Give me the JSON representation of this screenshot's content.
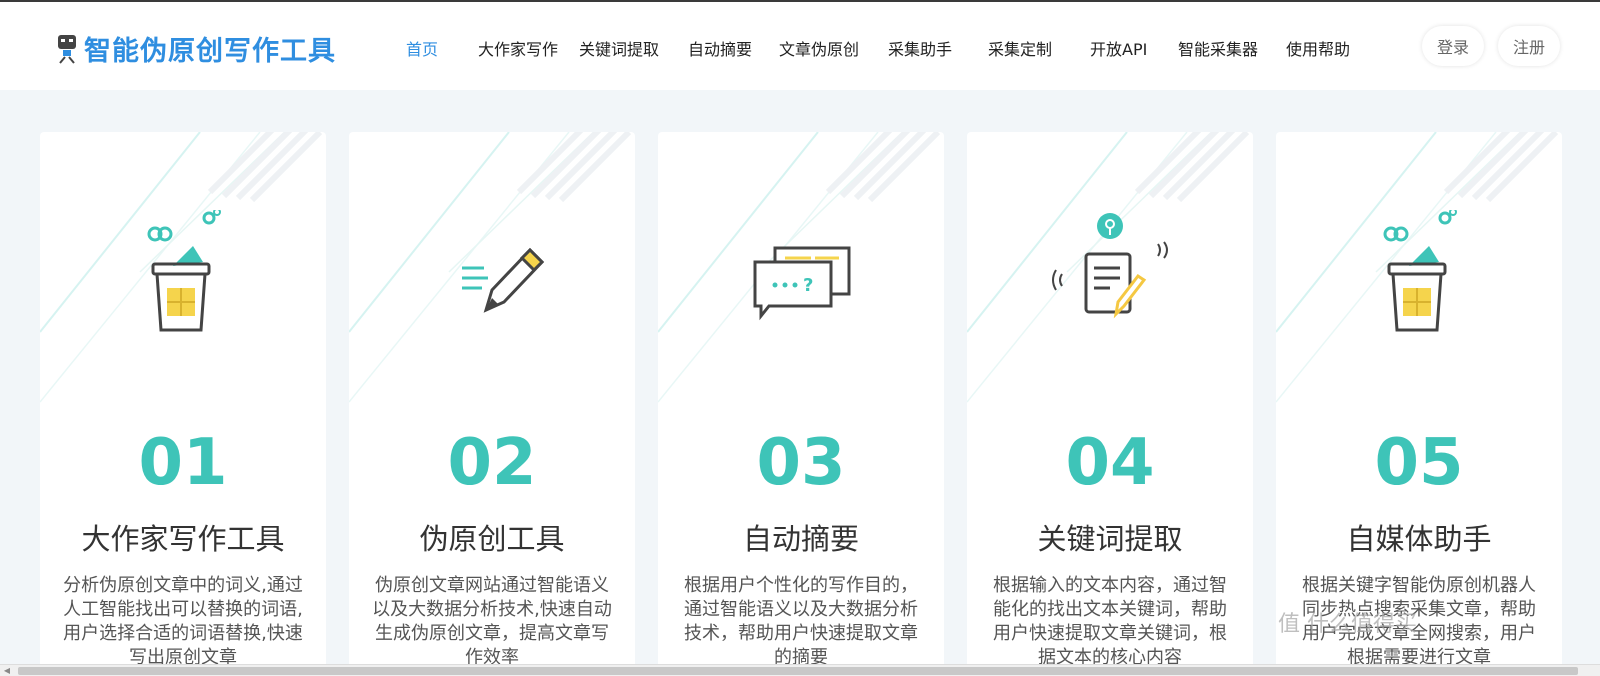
{
  "header": {
    "logo_text": "智能伪原创写作工具",
    "nav": [
      {
        "label": "首页",
        "active": true
      },
      {
        "label": "大作家写作"
      },
      {
        "label": "关键词提取"
      },
      {
        "label": "自动摘要"
      },
      {
        "label": "文章伪原创"
      },
      {
        "label": "采集助手"
      },
      {
        "label": "采集定制"
      },
      {
        "label": "开放API"
      },
      {
        "label": "智能采集器"
      },
      {
        "label": "使用帮助"
      }
    ],
    "login_label": "登录",
    "register_label": "注册"
  },
  "cards": [
    {
      "number": "01",
      "title": "大作家写作工具",
      "icon": "cup-social-icon",
      "desc": "分析伪原创文章中的词义,通过人工智能找出可以替换的词语,用户选择合适的词语替换,快速写出原创文章"
    },
    {
      "number": "02",
      "title": "伪原创工具",
      "icon": "pencil-icon",
      "desc": "伪原创文章网站通过智能语义以及大数据分析技术,快速自动生成伪原创文章，提高文章写作效率"
    },
    {
      "number": "03",
      "title": "自动摘要",
      "icon": "chat-bubbles-icon",
      "desc": "根据用户个性化的写作目的，通过智能语义以及大数据分析技术，帮助用户快速提取文章的摘要"
    },
    {
      "number": "04",
      "title": "关键词提取",
      "icon": "document-pen-icon",
      "desc": "根据输入的文本内容，通过智能化的找出文本关键词，帮助用户快速提取文章关键词，根据文本的核心内容"
    },
    {
      "number": "05",
      "title": "自媒体助手",
      "icon": "cup-social-icon",
      "desc": "根据关键字智能伪原创机器人同步热点搜索采集文章，帮助用户完成文章全网搜索，用户根据需要进行文章"
    }
  ],
  "watermark_text": "值 什么值得买",
  "colors": {
    "brand": "#2f8ee0",
    "accent": "#3ec4b8",
    "icon_yellow": "#f5d44c"
  }
}
